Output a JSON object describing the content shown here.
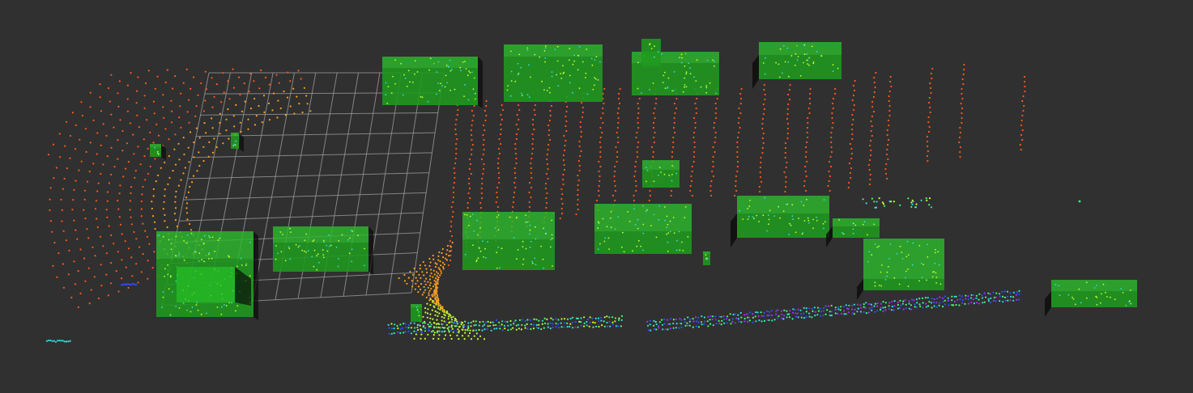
{
  "viewport": {
    "name": "3d-point-cloud-view",
    "background": "#303030"
  },
  "colors": {
    "box_front": "#1f9a1f",
    "box_top": "#2db82d",
    "box_side": "#157015",
    "box_shadow": "#0b0b0b",
    "grid": "#a0a0a0",
    "point_far": "#ff5a1a",
    "point_mid": "#ffa020",
    "point_near": "#c8ff30",
    "point_green": "#40ff80",
    "point_cyan": "#30e0e0",
    "point_blue": "#3050ff",
    "point_violet": "#a030ff"
  },
  "objects": [
    {
      "id": "box-1",
      "label": "bounding-box"
    },
    {
      "id": "box-2",
      "label": "bounding-box"
    },
    {
      "id": "box-3",
      "label": "bounding-box"
    },
    {
      "id": "box-4",
      "label": "bounding-box"
    },
    {
      "id": "box-5",
      "label": "bounding-box"
    },
    {
      "id": "box-6",
      "label": "bounding-box"
    },
    {
      "id": "box-7",
      "label": "bounding-box"
    },
    {
      "id": "box-8",
      "label": "bounding-box"
    },
    {
      "id": "box-9",
      "label": "bounding-box"
    },
    {
      "id": "box-10",
      "label": "bounding-box"
    },
    {
      "id": "box-11",
      "label": "bounding-box"
    },
    {
      "id": "box-12",
      "label": "bounding-box"
    },
    {
      "id": "box-13",
      "label": "bounding-box"
    },
    {
      "id": "box-14",
      "label": "bounding-box"
    },
    {
      "id": "box-15",
      "label": "bounding-box"
    },
    {
      "id": "box-16",
      "label": "bounding-box"
    },
    {
      "id": "box-17",
      "label": "bounding-box"
    },
    {
      "id": "box-18",
      "label": "bounding-box"
    }
  ]
}
